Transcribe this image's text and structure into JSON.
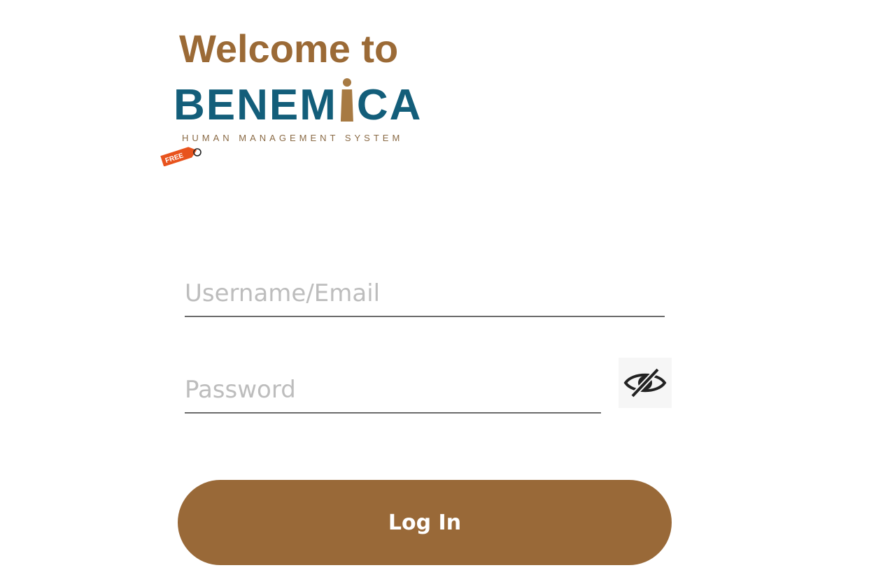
{
  "logo": {
    "welcome": "Welcome to",
    "brand_part1": "BENEM",
    "brand_part2": "CA",
    "tagline": "HUMAN MANAGEMENT SYSTEM",
    "free_tag": "FREE"
  },
  "form": {
    "username_placeholder": "Username/Email",
    "username_value": "",
    "password_placeholder": "Password",
    "password_value": "",
    "password_toggle_icon": "eye-slash-icon",
    "login_label": "Log In"
  },
  "colors": {
    "brand_brown": "#9b6a36",
    "brand_teal": "#135e7a",
    "button_bg": "#996938",
    "free_tag": "#e8531d"
  }
}
